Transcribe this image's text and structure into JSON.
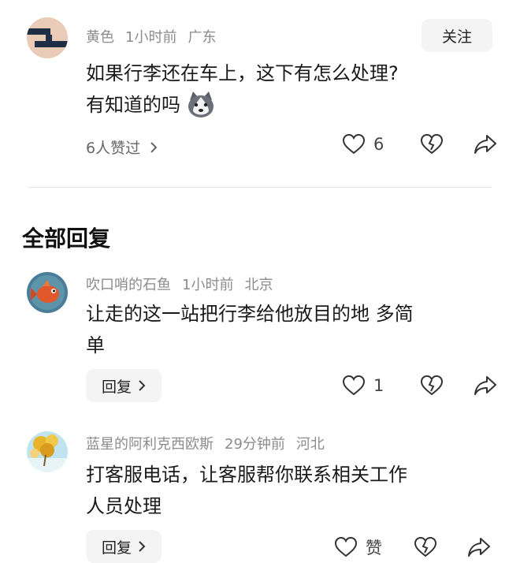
{
  "post": {
    "author": "黄色",
    "time": "1小时前",
    "location": "广东",
    "follow_label": "关注",
    "content_line1": "如果行李还在车上，这下有怎么处理?",
    "content_line2": "有知道的吗",
    "liked_by": "6人赞过",
    "like_count": "6",
    "emoji_icon": "husky-dog-face"
  },
  "section_title": "全部回复",
  "replies": [
    {
      "author": "吹口哨的石鱼",
      "time": "1小时前",
      "location": "北京",
      "content_line1": "让走的这一站把行李给他放目的地 多简",
      "content_line2": "单",
      "reply_label": "回复",
      "like_count": "1"
    },
    {
      "author": "蓝星的阿利克西欧斯",
      "time": "29分钟前",
      "location": "河北",
      "content_line1": "打客服电话，让客服帮你联系相关工作",
      "content_line2": "人员处理",
      "reply_label": "回复",
      "like_count": "赞"
    }
  ],
  "colors": {
    "meta_gray": "#8c8c8c",
    "button_bg": "#f4f4f4",
    "divider": "#e6e6e6"
  }
}
